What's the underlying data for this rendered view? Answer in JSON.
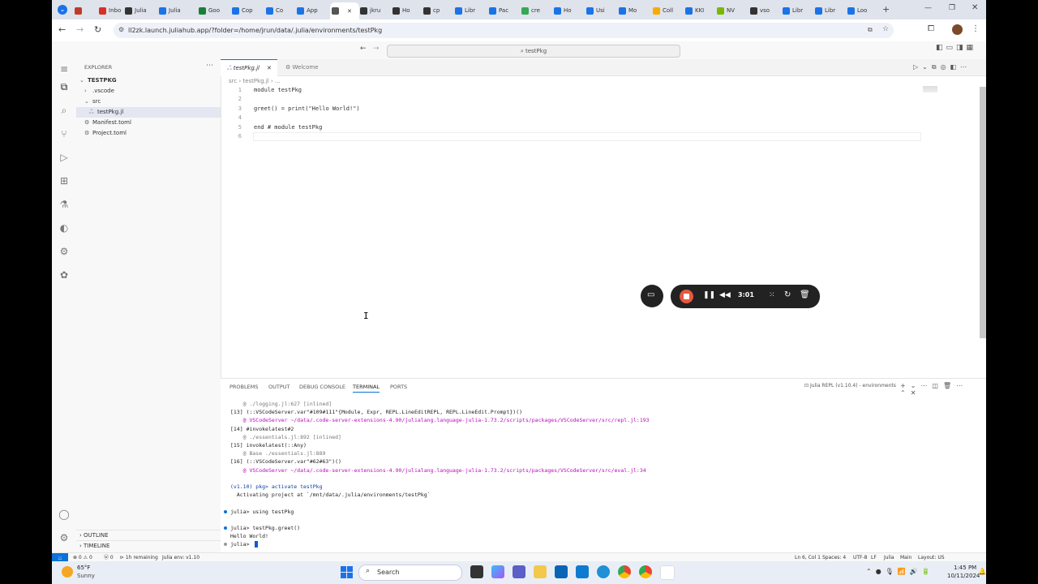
{
  "browser": {
    "tabs": [
      {
        "label": "",
        "color": "#c0392b"
      },
      {
        "label": "Inbo",
        "color": "#d93025"
      },
      {
        "label": "Julia",
        "color": "#333333"
      },
      {
        "label": "Julia",
        "color": "#1a73e8"
      },
      {
        "label": "Goo",
        "color": "#188038"
      },
      {
        "label": "Cop",
        "color": "#1a73e8"
      },
      {
        "label": "Co",
        "color": "#1a73e8"
      },
      {
        "label": "App",
        "color": "#1a73e8"
      },
      {
        "label": "",
        "color": "#555555"
      },
      {
        "label": "jkru",
        "color": "#333333"
      },
      {
        "label": "Ho",
        "color": "#333333"
      },
      {
        "label": "cp",
        "color": "#333333"
      },
      {
        "label": "Libr",
        "color": "#1a73e8"
      },
      {
        "label": "Pac",
        "color": "#1a73e8"
      },
      {
        "label": "cre",
        "color": "#34a853"
      },
      {
        "label": "Ho",
        "color": "#1a73e8"
      },
      {
        "label": "Usi",
        "color": "#1a73e8"
      },
      {
        "label": "Mo",
        "color": "#1a73e8"
      },
      {
        "label": "Coll",
        "color": "#f9ab00"
      },
      {
        "label": "KKI",
        "color": "#1a73e8"
      },
      {
        "label": "NV",
        "color": "#76b900"
      },
      {
        "label": "vso",
        "color": "#333333"
      },
      {
        "label": "Libr",
        "color": "#1a73e8"
      },
      {
        "label": "Libr",
        "color": "#1a73e8"
      },
      {
        "label": "Loo",
        "color": "#1a73e8"
      }
    ],
    "url": "ll2zk.launch.juliahub.app/?folder=/home/jrun/data/.julia/environments/testPkg"
  },
  "vscode": {
    "command_center": "testPkg",
    "explorer_title": "EXPLORER",
    "tree": [
      {
        "label": "TESTPKG",
        "indent": 0,
        "caret": "⌄",
        "bold": true
      },
      {
        "label": ".vscode",
        "indent": 1,
        "caret": "›"
      },
      {
        "label": "src",
        "indent": 1,
        "caret": "⌄"
      },
      {
        "label": "testPkg.jl",
        "indent": 2,
        "caret": "",
        "selected": true
      },
      {
        "label": "Manifest.toml",
        "indent": 1,
        "caret": ""
      },
      {
        "label": "Project.toml",
        "indent": 1,
        "caret": ""
      }
    ],
    "outline": "OUTLINE",
    "timeline": "TIMELINE",
    "editor_tabs": [
      "testPkg.jl",
      "Welcome"
    ],
    "breadcrumb": "src  ›  testPkg.jl  ›  ...",
    "code_lines": [
      {
        "n": "1",
        "t": "module testPkg"
      },
      {
        "n": "2",
        "t": ""
      },
      {
        "n": "3",
        "t": "greet() = print(\"Hello World!\")"
      },
      {
        "n": "4",
        "t": ""
      },
      {
        "n": "5",
        "t": "end # module testPkg"
      },
      {
        "n": "6",
        "t": ""
      }
    ],
    "panel_tabs": [
      "PROBLEMS",
      "OUTPUT",
      "DEBUG CONSOLE",
      "TERMINAL",
      "PORTS"
    ],
    "terminal_name": "Julia REPL (v1.10.4) - environments",
    "terminal_lines": [
      {
        "t": "    @ ./logging.jl:627 [inlined]",
        "c": "grey"
      },
      {
        "t": "[13] (::VSCodeServer.var\"#109#111\"{Module, Expr, REPL.LineEditREPL, REPL.LineEdit.Prompt})()",
        "c": ""
      },
      {
        "t": "    @ VSCodeServer ~/data/.code-server-extensions-4.90/julialang.language-julia-1.73.2/scripts/packages/VSCodeServer/src/repl.jl:193",
        "c": "mag"
      },
      {
        "t": "[14] #invokelatest#2",
        "c": ""
      },
      {
        "t": "    @ ./essentials.jl:892 [inlined]",
        "c": "grey"
      },
      {
        "t": "[15] invokelatest(::Any)",
        "c": ""
      },
      {
        "t": "    @ Base ./essentials.jl:889",
        "c": "grey"
      },
      {
        "t": "[16] (::VSCodeServer.var\"#62#63\")()",
        "c": ""
      },
      {
        "t": "    @ VSCodeServer ~/data/.code-server-extensions-4.90/julialang.language-julia-1.73.2/scripts/packages/VSCodeServer/src/eval.jl:34",
        "c": "mag"
      },
      {
        "t": "",
        "c": ""
      },
      {
        "t": "(v1.10) pkg> activate testPkg",
        "c": "blue"
      },
      {
        "t": "  Activating project at `/mnt/data/.julia/environments/testPkg`",
        "c": ""
      },
      {
        "t": "",
        "c": ""
      },
      {
        "t": "julia> using testPkg",
        "c": ""
      },
      {
        "t": "",
        "c": ""
      },
      {
        "t": "julia> testPkg.greet()",
        "c": ""
      },
      {
        "t": "Hello World!",
        "c": ""
      },
      {
        "t": "julia> ",
        "c": ""
      }
    ],
    "status_left": [
      "⊗ 0 ⚠ 0",
      "ⓦ 0",
      "⊳ 1h remaining",
      "Julia env: v1.10"
    ],
    "status_right": [
      "Ln 6, Col 1",
      "Spaces: 4",
      "UTF-8",
      "LF",
      "Julia",
      "Main",
      "Layout: US"
    ]
  },
  "recorder": {
    "time": "3:01"
  },
  "taskbar": {
    "weather_temp": "65°F",
    "weather_desc": "Sunny",
    "search": "Search",
    "time": "1:45 PM",
    "date": "10/11/2024"
  }
}
